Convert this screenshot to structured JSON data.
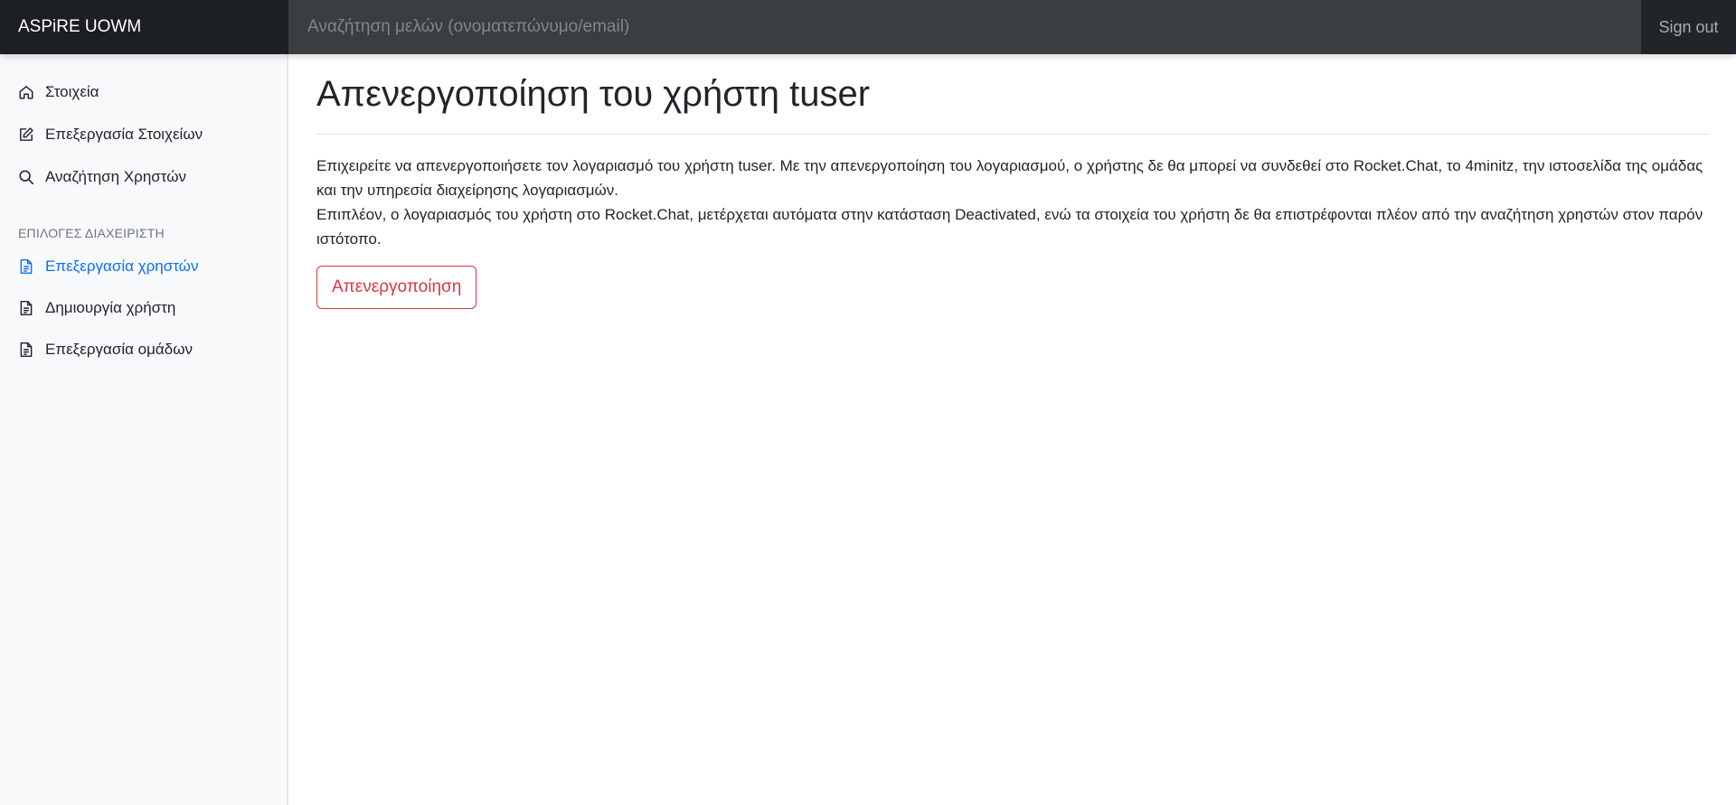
{
  "navbar": {
    "brand": "ASPiRE UOWM",
    "search_placeholder": "Αναζήτηση μελών (ονοματεπώνυμο/email)",
    "signout_label": "Sign out"
  },
  "sidebar": {
    "items": [
      {
        "label": "Στοιχεία",
        "icon": "home-icon"
      },
      {
        "label": "Επεξεργασία Στοιχείων",
        "icon": "edit-icon"
      },
      {
        "label": "Αναζήτηση Χρηστών",
        "icon": "search-icon"
      }
    ],
    "admin_heading": "ΕΠΙΛΟΓΕΣ ΔΙΑΧΕΙΡΙΣΤΗ",
    "admin_items": [
      {
        "label": "Επεξεργασία χρηστών",
        "icon": "file-icon",
        "active": true
      },
      {
        "label": "Δημιουργία χρήστη",
        "icon": "file-icon"
      },
      {
        "label": "Επεξεργασία ομάδων",
        "icon": "file-icon"
      }
    ]
  },
  "main": {
    "title": "Απενεργοποίηση του χρήστη tuser",
    "paragraph_1": "Επιχειρείτε να απενεργοποιήσετε τον λογαριασμό του χρήστη tuser. Με την απενεργοποίηση του λογαριασμού, ο χρήστης δε θα μπορεί να συνδεθεί στο Rocket.Chat, το 4minitz, την ιστοσελίδα της ομάδας και την υπηρεσία διαχείρησης λογαριασμών.",
    "paragraph_2": "Επιπλέον, ο λογαριασμός του χρήστη στο Rocket.Chat, μετέρχεται αυτόματα στην κατάσταση Deactivated, ενώ τα στοιχεία του χρήστη δε θα επιστρέφονται πλέον από την αναζήτηση χρηστών στον παρόν ιστότοπο.",
    "deactivate_label": "Απενεργοποίηση"
  },
  "colors": {
    "navbar_bg": "#212529",
    "accent": "#0d6efd",
    "danger": "#dc3545",
    "sidebar_bg": "#f8f9fa"
  }
}
